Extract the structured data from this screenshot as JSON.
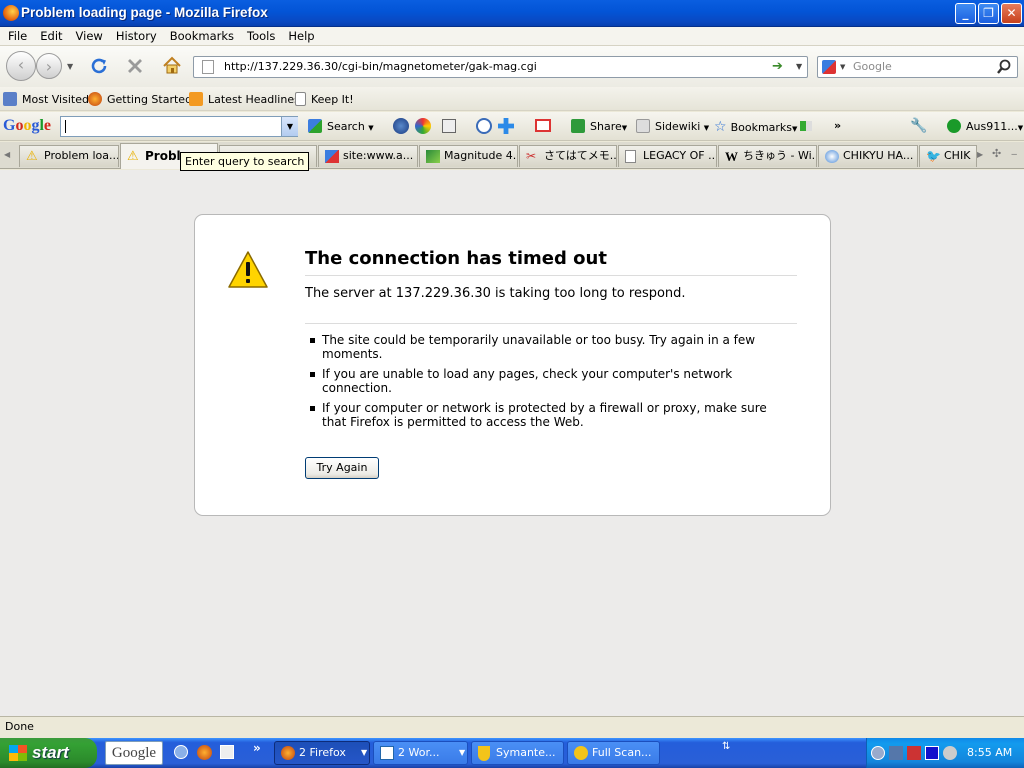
{
  "window": {
    "title": "Problem loading page - Mozilla Firefox"
  },
  "menu": [
    "File",
    "Edit",
    "View",
    "History",
    "Bookmarks",
    "Tools",
    "Help"
  ],
  "nav": {
    "url": "http://137.229.36.30/cgi-bin/magnetometer/gak-mag.cgi",
    "search_placeholder": "Google"
  },
  "bookmarks": [
    "Most Visited",
    "Getting Started",
    "Latest Headlines",
    "Keep It!"
  ],
  "google_toolbar": {
    "logo": "Google",
    "search_label": "Search",
    "share": "Share",
    "sidewiki": "Sidewiki",
    "bookmarks": "Bookmarks",
    "more": "»",
    "account": "Aus911..."
  },
  "tabs": [
    {
      "label": "Problem loa..."
    },
    {
      "label": "Proble"
    },
    {
      "label": "site:www.a..."
    },
    {
      "label": "Magnitude 4..."
    },
    {
      "label": "さてはてメモ..."
    },
    {
      "label": "LEGACY OF ..."
    },
    {
      "label": "ちきゅう - Wi..."
    },
    {
      "label": "CHIKYU HA..."
    },
    {
      "label": "CHIK"
    }
  ],
  "tooltip": "Enter query to search",
  "error": {
    "title": "The connection has timed out",
    "description": "The server at 137.229.36.30 is taking too long to respond.",
    "items": [
      "The site could be temporarily unavailable or too busy. Try again in a few moments.",
      "If you are unable to load any pages, check your computer's network connection.",
      "If your computer or network is protected by a firewall or proxy, make sure that Firefox is permitted to access the Web."
    ],
    "button": "Try Again"
  },
  "status": "Done",
  "taskbar": {
    "start": "start",
    "google_label": "Google",
    "buttons": [
      "2 Firefox",
      "2 Wor...",
      "Symante...",
      "Full Scan..."
    ],
    "clock": "8:55 AM"
  }
}
